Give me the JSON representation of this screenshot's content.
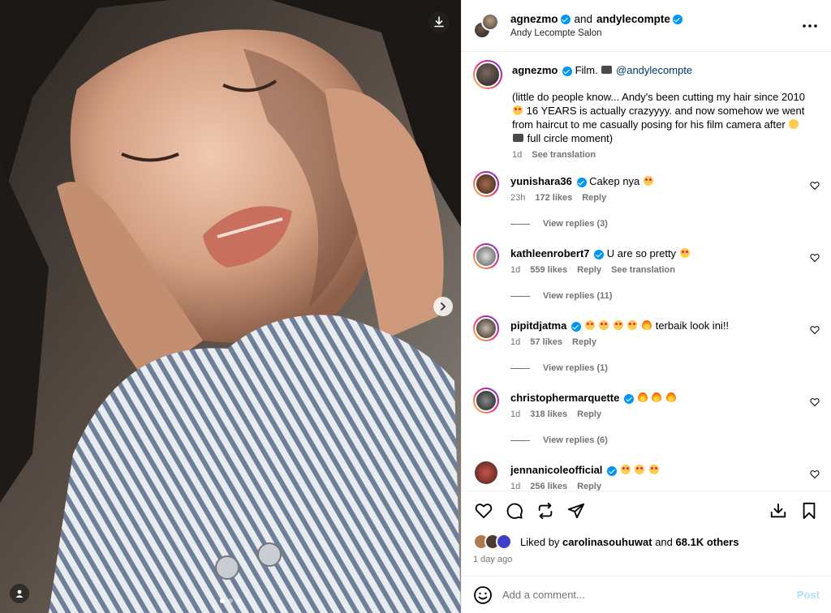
{
  "header": {
    "user1": "agnezmo",
    "and_text": "and",
    "user2": "andylecompte",
    "location": "Andy Lecompte Salon",
    "more_icon": "more-horizontal-icon"
  },
  "caption": {
    "username": "agnezmo",
    "first_line_text": "Film.",
    "mention": "@andylecompte",
    "body_part1": "(little do people know... Andy's been cutting my hair since 2010",
    "body_part2": "16 YEARS is actually crazyyyy. and now somehow we went from haircut to me casually posing for his film camera after",
    "body_part3": "full circle moment)",
    "time": "1d",
    "see_translation": "See translation"
  },
  "comments": [
    {
      "username": "yunishara36",
      "text": "Cakep nya",
      "time": "23h",
      "likes": "172 likes",
      "reply": "Reply",
      "see_translation": "",
      "view_replies": "View replies (3)"
    },
    {
      "username": "kathleenrobert7",
      "text": "U are so pretty",
      "time": "1d",
      "likes": "559 likes",
      "reply": "Reply",
      "see_translation": "See translation",
      "view_replies": "View replies (11)"
    },
    {
      "username": "pipitdjatma",
      "text": "terbaik look ini!!",
      "time": "1d",
      "likes": "57 likes",
      "reply": "Reply",
      "see_translation": "",
      "view_replies": "View replies (1)"
    },
    {
      "username": "christophermarquette",
      "text": "",
      "time": "1d",
      "likes": "318 likes",
      "reply": "Reply",
      "see_translation": "",
      "view_replies": "View replies (6)"
    },
    {
      "username": "jennanicoleofficial",
      "text": "",
      "time": "1d",
      "likes": "256 likes",
      "reply": "Reply",
      "see_translation": "",
      "view_replies": ""
    }
  ],
  "actions": {
    "liked_by_prefix": "Liked by",
    "liked_by_user": "carolinasouhuwat",
    "and_text": "and",
    "others": "68.1K others",
    "time_ago": "1 day ago"
  },
  "add_comment": {
    "placeholder": "Add a comment...",
    "post_label": "Post"
  },
  "colors": {
    "verified": "#0095f6",
    "mention": "#00376b",
    "meta": "#737373",
    "post_disabled": "#b2dffc"
  }
}
